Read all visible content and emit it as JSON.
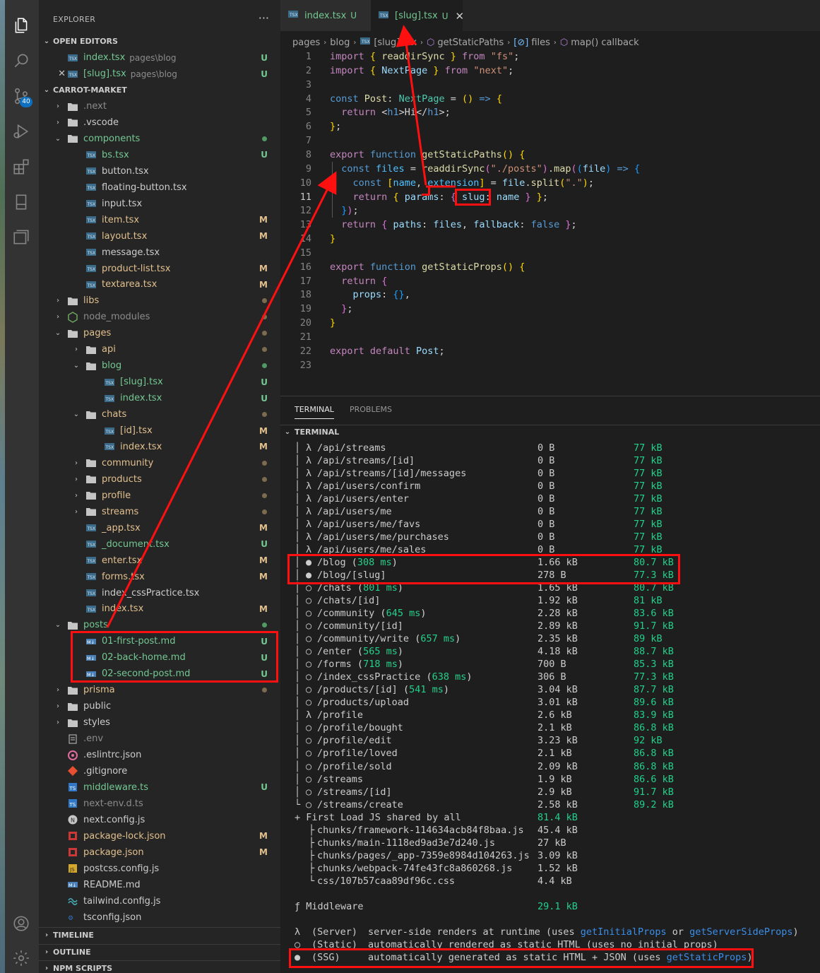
{
  "colors": {
    "accent": "#0e70c0",
    "untracked": "#73c991",
    "modified": "#e2c08d",
    "annotation": "#ff1010"
  },
  "activity_bar": {
    "icons": [
      "files-icon",
      "search-icon",
      "source-control-icon",
      "run-debug-icon",
      "extensions-icon",
      "bookmark-icon",
      "remote-explorer-icon",
      "account-icon",
      "settings-gear-icon"
    ],
    "scm_badge": "40"
  },
  "sidebar": {
    "title": "EXPLORER",
    "more": "···",
    "open_editors": {
      "heading": "OPEN EDITORS",
      "items": [
        {
          "name": "index.tsx",
          "path": "pages\\blog",
          "status": "U"
        },
        {
          "name": "[slug].tsx",
          "path": "pages\\blog",
          "status": "U"
        }
      ]
    },
    "project": "CARROT-MARKET",
    "tree": [
      {
        "name": ".next",
        "status": ""
      },
      {
        "name": ".vscode",
        "status": ""
      },
      {
        "name": "components",
        "status": ""
      },
      {
        "name": "bs.tsx",
        "status": "U"
      },
      {
        "name": "button.tsx",
        "status": ""
      },
      {
        "name": "floating-button.tsx",
        "status": ""
      },
      {
        "name": "input.tsx",
        "status": ""
      },
      {
        "name": "item.tsx",
        "status": "M"
      },
      {
        "name": "layout.tsx",
        "status": "M"
      },
      {
        "name": "message.tsx",
        "status": ""
      },
      {
        "name": "product-list.tsx",
        "status": "M"
      },
      {
        "name": "textarea.tsx",
        "status": "M"
      },
      {
        "name": "libs",
        "status": ""
      },
      {
        "name": "node_modules",
        "status": ""
      },
      {
        "name": "pages",
        "status": ""
      },
      {
        "name": "api",
        "status": ""
      },
      {
        "name": "blog",
        "status": ""
      },
      {
        "name": "[slug].tsx",
        "status": "U"
      },
      {
        "name": "index.tsx",
        "status": "U"
      },
      {
        "name": "chats",
        "status": ""
      },
      {
        "name": "[id].tsx",
        "status": "M"
      },
      {
        "name": "index.tsx",
        "status": "M"
      },
      {
        "name": "community",
        "status": ""
      },
      {
        "name": "products",
        "status": ""
      },
      {
        "name": "profile",
        "status": ""
      },
      {
        "name": "streams",
        "status": ""
      },
      {
        "name": "_app.tsx",
        "status": "M"
      },
      {
        "name": "_document.tsx",
        "status": "U"
      },
      {
        "name": "enter.tsx",
        "status": "M"
      },
      {
        "name": "forms.tsx",
        "status": "M"
      },
      {
        "name": "index_cssPractice.tsx",
        "status": ""
      },
      {
        "name": "index.tsx",
        "status": "M"
      },
      {
        "name": "posts",
        "status": ""
      },
      {
        "name": "01-first-post.md",
        "status": "U"
      },
      {
        "name": "02-back-home.md",
        "status": "U"
      },
      {
        "name": "02-second-post.md",
        "status": "U"
      },
      {
        "name": "prisma",
        "status": ""
      },
      {
        "name": "public",
        "status": ""
      },
      {
        "name": "styles",
        "status": ""
      },
      {
        "name": ".env",
        "status": ""
      },
      {
        "name": ".eslintrc.json",
        "status": ""
      },
      {
        "name": ".gitignore",
        "status": ""
      },
      {
        "name": "middleware.ts",
        "status": "U"
      },
      {
        "name": "next-env.d.ts",
        "status": ""
      },
      {
        "name": "next.config.js",
        "status": ""
      },
      {
        "name": "package-lock.json",
        "status": "M"
      },
      {
        "name": "package.json",
        "status": "M"
      },
      {
        "name": "postcss.config.js",
        "status": ""
      },
      {
        "name": "README.md",
        "status": ""
      },
      {
        "name": "tailwind.config.js",
        "status": ""
      },
      {
        "name": "tsconfig.json",
        "status": ""
      }
    ],
    "bottom_sections": [
      "TIMELINE",
      "OUTLINE",
      "NPM SCRIPTS"
    ]
  },
  "editor": {
    "tabs": [
      {
        "name": "index.tsx",
        "status": "U",
        "close": ""
      },
      {
        "name": "[slug].tsx",
        "status": "U",
        "close": "✕"
      }
    ],
    "breadcrumb": [
      "pages",
      "blog",
      "[slug].tsx",
      "getStaticPaths",
      "files",
      "map() callback"
    ],
    "lines": [
      "import { readdirSync } from \"fs\";",
      "import { NextPage } from \"next\";",
      "",
      "const Post: NextPage = () => {",
      "  return <h1>Hi</h1>;",
      "};",
      "",
      "export function getStaticPaths() {",
      "  const files = readdirSync(\"./posts\").map((file) => {",
      "    const [name, extension] = file.split(\".\");",
      "    return { params: { slug: name } };",
      "  });",
      "  return { paths: files, fallback: false };",
      "}",
      "",
      "export function getStaticProps() {",
      "  return {",
      "    props: {},",
      "  };",
      "}",
      "",
      "export default Post;",
      ""
    ],
    "current_line": 11
  },
  "panel": {
    "tabs": [
      "TERMINAL",
      "PROBLEMS"
    ],
    "header": "TERMINAL",
    "routes": [
      {
        "sym": "λ",
        "path": "/api/streams",
        "ms": "",
        "size": "0 B",
        "first": "77 kB"
      },
      {
        "sym": "λ",
        "path": "/api/streams/[id]",
        "ms": "",
        "size": "0 B",
        "first": "77 kB"
      },
      {
        "sym": "λ",
        "path": "/api/streams/[id]/messages",
        "ms": "",
        "size": "0 B",
        "first": "77 kB"
      },
      {
        "sym": "λ",
        "path": "/api/users/confirm",
        "ms": "",
        "size": "0 B",
        "first": "77 kB"
      },
      {
        "sym": "λ",
        "path": "/api/users/enter",
        "ms": "",
        "size": "0 B",
        "first": "77 kB"
      },
      {
        "sym": "λ",
        "path": "/api/users/me",
        "ms": "",
        "size": "0 B",
        "first": "77 kB"
      },
      {
        "sym": "λ",
        "path": "/api/users/me/favs",
        "ms": "",
        "size": "0 B",
        "first": "77 kB"
      },
      {
        "sym": "λ",
        "path": "/api/users/me/purchases",
        "ms": "",
        "size": "0 B",
        "first": "77 kB"
      },
      {
        "sym": "λ",
        "path": "/api/users/me/sales",
        "ms": "",
        "size": "0 B",
        "first": "77 kB"
      },
      {
        "sym": "●",
        "path": "/blog",
        "ms": "308 ms",
        "size": "1.66 kB",
        "first": "80.7 kB"
      },
      {
        "sym": "●",
        "path": "/blog/[slug]",
        "ms": "",
        "size": "278 B",
        "first": "77.3 kB"
      },
      {
        "sym": "○",
        "path": "/chats",
        "ms": "801 ms",
        "size": "1.65 kB",
        "first": "80.7 kB"
      },
      {
        "sym": "○",
        "path": "/chats/[id]",
        "ms": "",
        "size": "1.92 kB",
        "first": "81 kB"
      },
      {
        "sym": "○",
        "path": "/community",
        "ms": "645 ms",
        "size": "2.28 kB",
        "first": "83.6 kB"
      },
      {
        "sym": "○",
        "path": "/community/[id]",
        "ms": "",
        "size": "2.89 kB",
        "first": "91.7 kB"
      },
      {
        "sym": "○",
        "path": "/community/write",
        "ms": "657 ms",
        "size": "2.35 kB",
        "first": "89 kB"
      },
      {
        "sym": "○",
        "path": "/enter",
        "ms": "565 ms",
        "size": "4.18 kB",
        "first": "88.7 kB"
      },
      {
        "sym": "○",
        "path": "/forms",
        "ms": "718 ms",
        "size": "700 B",
        "first": "85.3 kB"
      },
      {
        "sym": "○",
        "path": "/index_cssPractice",
        "ms": "638 ms",
        "size": "306 B",
        "first": "77.3 kB"
      },
      {
        "sym": "○",
        "path": "/products/[id]",
        "ms": "541 ms",
        "size": "3.04 kB",
        "first": "87.7 kB"
      },
      {
        "sym": "○",
        "path": "/products/upload",
        "ms": "",
        "size": "3.01 kB",
        "first": "89.6 kB"
      },
      {
        "sym": "λ",
        "path": "/profile",
        "ms": "",
        "size": "2.6 kB",
        "first": "83.9 kB"
      },
      {
        "sym": "○",
        "path": "/profile/bought",
        "ms": "",
        "size": "2.1 kB",
        "first": "86.8 kB"
      },
      {
        "sym": "○",
        "path": "/profile/edit",
        "ms": "",
        "size": "3.23 kB",
        "first": "92 kB"
      },
      {
        "sym": "○",
        "path": "/profile/loved",
        "ms": "",
        "size": "2.1 kB",
        "first": "86.8 kB"
      },
      {
        "sym": "○",
        "path": "/profile/sold",
        "ms": "",
        "size": "2.09 kB",
        "first": "86.8 kB"
      },
      {
        "sym": "○",
        "path": "/streams",
        "ms": "",
        "size": "1.9 kB",
        "first": "86.6 kB"
      },
      {
        "sym": "○",
        "path": "/streams/[id]",
        "ms": "",
        "size": "2.9 kB",
        "first": "91.7 kB"
      },
      {
        "sym": "○",
        "path": "/streams/create",
        "ms": "",
        "size": "2.58 kB",
        "first": "89.2 kB"
      }
    ],
    "shared_label": "+ First Load JS shared by all",
    "shared_size": "81.4 kB",
    "chunks": [
      {
        "name": "chunks/framework-114634acb84f8baa.js",
        "size": "45.4 kB"
      },
      {
        "name": "chunks/main-1118ed9ad3e7d240.js",
        "size": "27 kB"
      },
      {
        "name": "chunks/pages/_app-7359e8984d104263.js",
        "size": "3.09 kB"
      },
      {
        "name": "chunks/webpack-74fe43fc8a860268.js",
        "size": "1.52 kB"
      },
      {
        "name": "css/107b57caa89df96c.css",
        "size": "4.4 kB"
      }
    ],
    "middleware_label": "ƒ Middleware",
    "middleware_size": "29.1 kB",
    "legend": [
      {
        "sym": "λ",
        "kind": "(Server)",
        "text": "server-side renders at runtime (uses ",
        "link1": "getInitialProps",
        "mid": " or ",
        "link2": "getServerSideProps",
        "end": ")"
      },
      {
        "sym": "○",
        "kind": "(Static)",
        "text": "automatically rendered as static HTML (uses no initial props)",
        "link1": "",
        "mid": "",
        "link2": "",
        "end": ""
      },
      {
        "sym": "●",
        "kind": "(SSG)",
        "text": "automatically generated as static HTML + JSON (uses ",
        "link1": "getStaticProps",
        "mid": "",
        "link2": "",
        "end": ")"
      }
    ]
  }
}
